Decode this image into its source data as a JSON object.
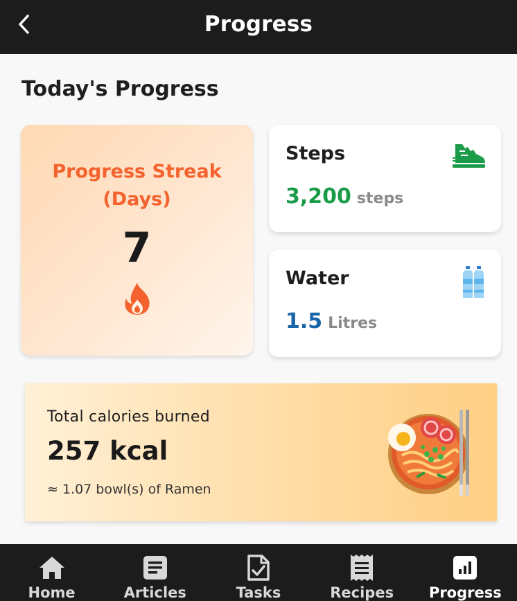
{
  "header": {
    "title": "Progress",
    "back_icon": "chevron-left-icon"
  },
  "section_title": "Today's Progress",
  "streak": {
    "label": "Progress Streak (Days)",
    "value": "7",
    "icon": "fire-icon",
    "color": "#f4622d"
  },
  "steps": {
    "title": "Steps",
    "value": "3,200",
    "unit": "steps",
    "icon": "shoe-icon",
    "color": "#1c9c4a"
  },
  "water": {
    "title": "Water",
    "value": "1.5",
    "unit": "Litres",
    "icon": "water-bottles-icon",
    "color": "#1a64a8"
  },
  "calories": {
    "title": "Total calories burned",
    "value": "257 kcal",
    "note": "≈ 1.07 bowl(s) of Ramen",
    "image": "ramen-bowl-icon"
  },
  "nav": {
    "items": [
      {
        "label": "Home",
        "icon": "home-icon"
      },
      {
        "label": "Articles",
        "icon": "article-icon"
      },
      {
        "label": "Tasks",
        "icon": "task-icon"
      },
      {
        "label": "Recipes",
        "icon": "receipt-icon"
      },
      {
        "label": "Progress",
        "icon": "progress-chart-icon",
        "active": true
      }
    ]
  }
}
